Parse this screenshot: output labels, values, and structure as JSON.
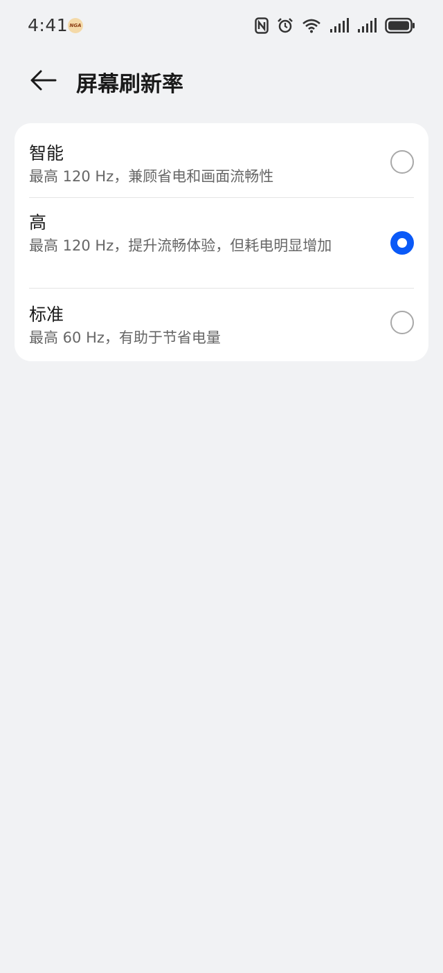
{
  "status_bar": {
    "time": "4:41",
    "badge": "NGA",
    "icons": [
      "nfc-icon",
      "alarm-icon",
      "wifi-icon",
      "signal-1-icon",
      "signal-2-icon",
      "battery-icon"
    ]
  },
  "header": {
    "title": "屏幕刷新率",
    "back_icon": "arrow-left-icon"
  },
  "options": [
    {
      "title": "智能",
      "desc": "最高 120 Hz，兼顾省电和画面流畅性",
      "selected": false
    },
    {
      "title": "高",
      "desc": "最高 120 Hz，提升流畅体验，但耗电明显增加",
      "selected": true
    },
    {
      "title": "标准",
      "desc": "最高 60 Hz，有助于节省电量",
      "selected": false
    }
  ],
  "colors": {
    "accent": "#0a59f7",
    "background": "#f1f2f4",
    "card": "#ffffff"
  }
}
